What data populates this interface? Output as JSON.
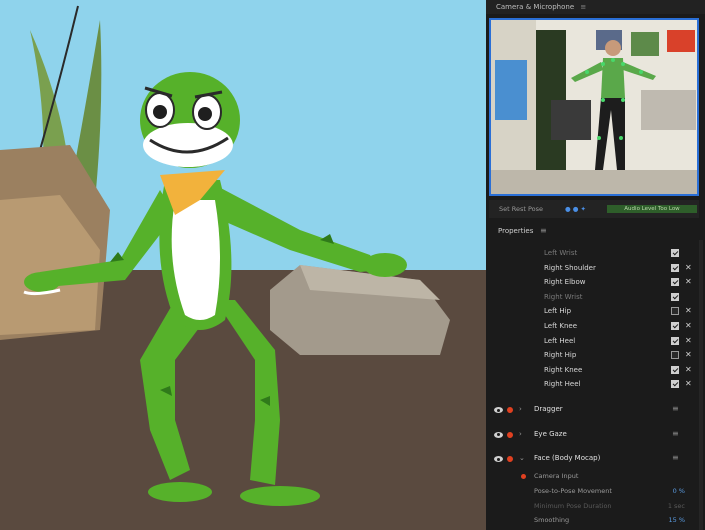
{
  "camera_panel": {
    "title": "Camera & Microphone",
    "set_rest_pose_label": "Set Rest Pose",
    "audio_level": "Audio Level Too Low"
  },
  "properties": {
    "title": "Properties",
    "joints": [
      {
        "label": "Left Wrist",
        "checked": true,
        "x": false,
        "dim": true
      },
      {
        "label": "Right Shoulder",
        "checked": true,
        "x": true,
        "dim": false
      },
      {
        "label": "Right Elbow",
        "checked": true,
        "x": true,
        "dim": false
      },
      {
        "label": "Right Wrist",
        "checked": true,
        "x": false,
        "dim": true
      },
      {
        "label": "Left Hip",
        "checked": false,
        "x": true,
        "dim": false
      },
      {
        "label": "Left Knee",
        "checked": true,
        "x": true,
        "dim": false
      },
      {
        "label": "Left Heel",
        "checked": true,
        "x": true,
        "dim": false
      },
      {
        "label": "Right Hip",
        "checked": false,
        "x": true,
        "dim": false
      },
      {
        "label": "Right Knee",
        "checked": true,
        "x": true,
        "dim": false
      },
      {
        "label": "Right Heel",
        "checked": true,
        "x": true,
        "dim": false
      }
    ],
    "behaviors": [
      {
        "name": "Dragger",
        "expanded": false
      },
      {
        "name": "Eye Gaze",
        "expanded": false
      },
      {
        "name": "Face (Body Mocap)",
        "expanded": true
      }
    ],
    "face_params": [
      {
        "name": "Camera Input",
        "value": "",
        "dim": false
      },
      {
        "name": "Pose-to-Pose Movement",
        "value": "0 %",
        "dim": false
      },
      {
        "name": "Minimum Pose Duration",
        "value": "1 sec",
        "dim": true
      },
      {
        "name": "Smoothing",
        "value": "15 %",
        "dim": false
      }
    ]
  },
  "colors": {
    "accent": "#2a6fd6",
    "record": "#e04020",
    "frog": "#56b12a",
    "sky": "#8fd3ec",
    "ground": "#5a4a3f"
  }
}
